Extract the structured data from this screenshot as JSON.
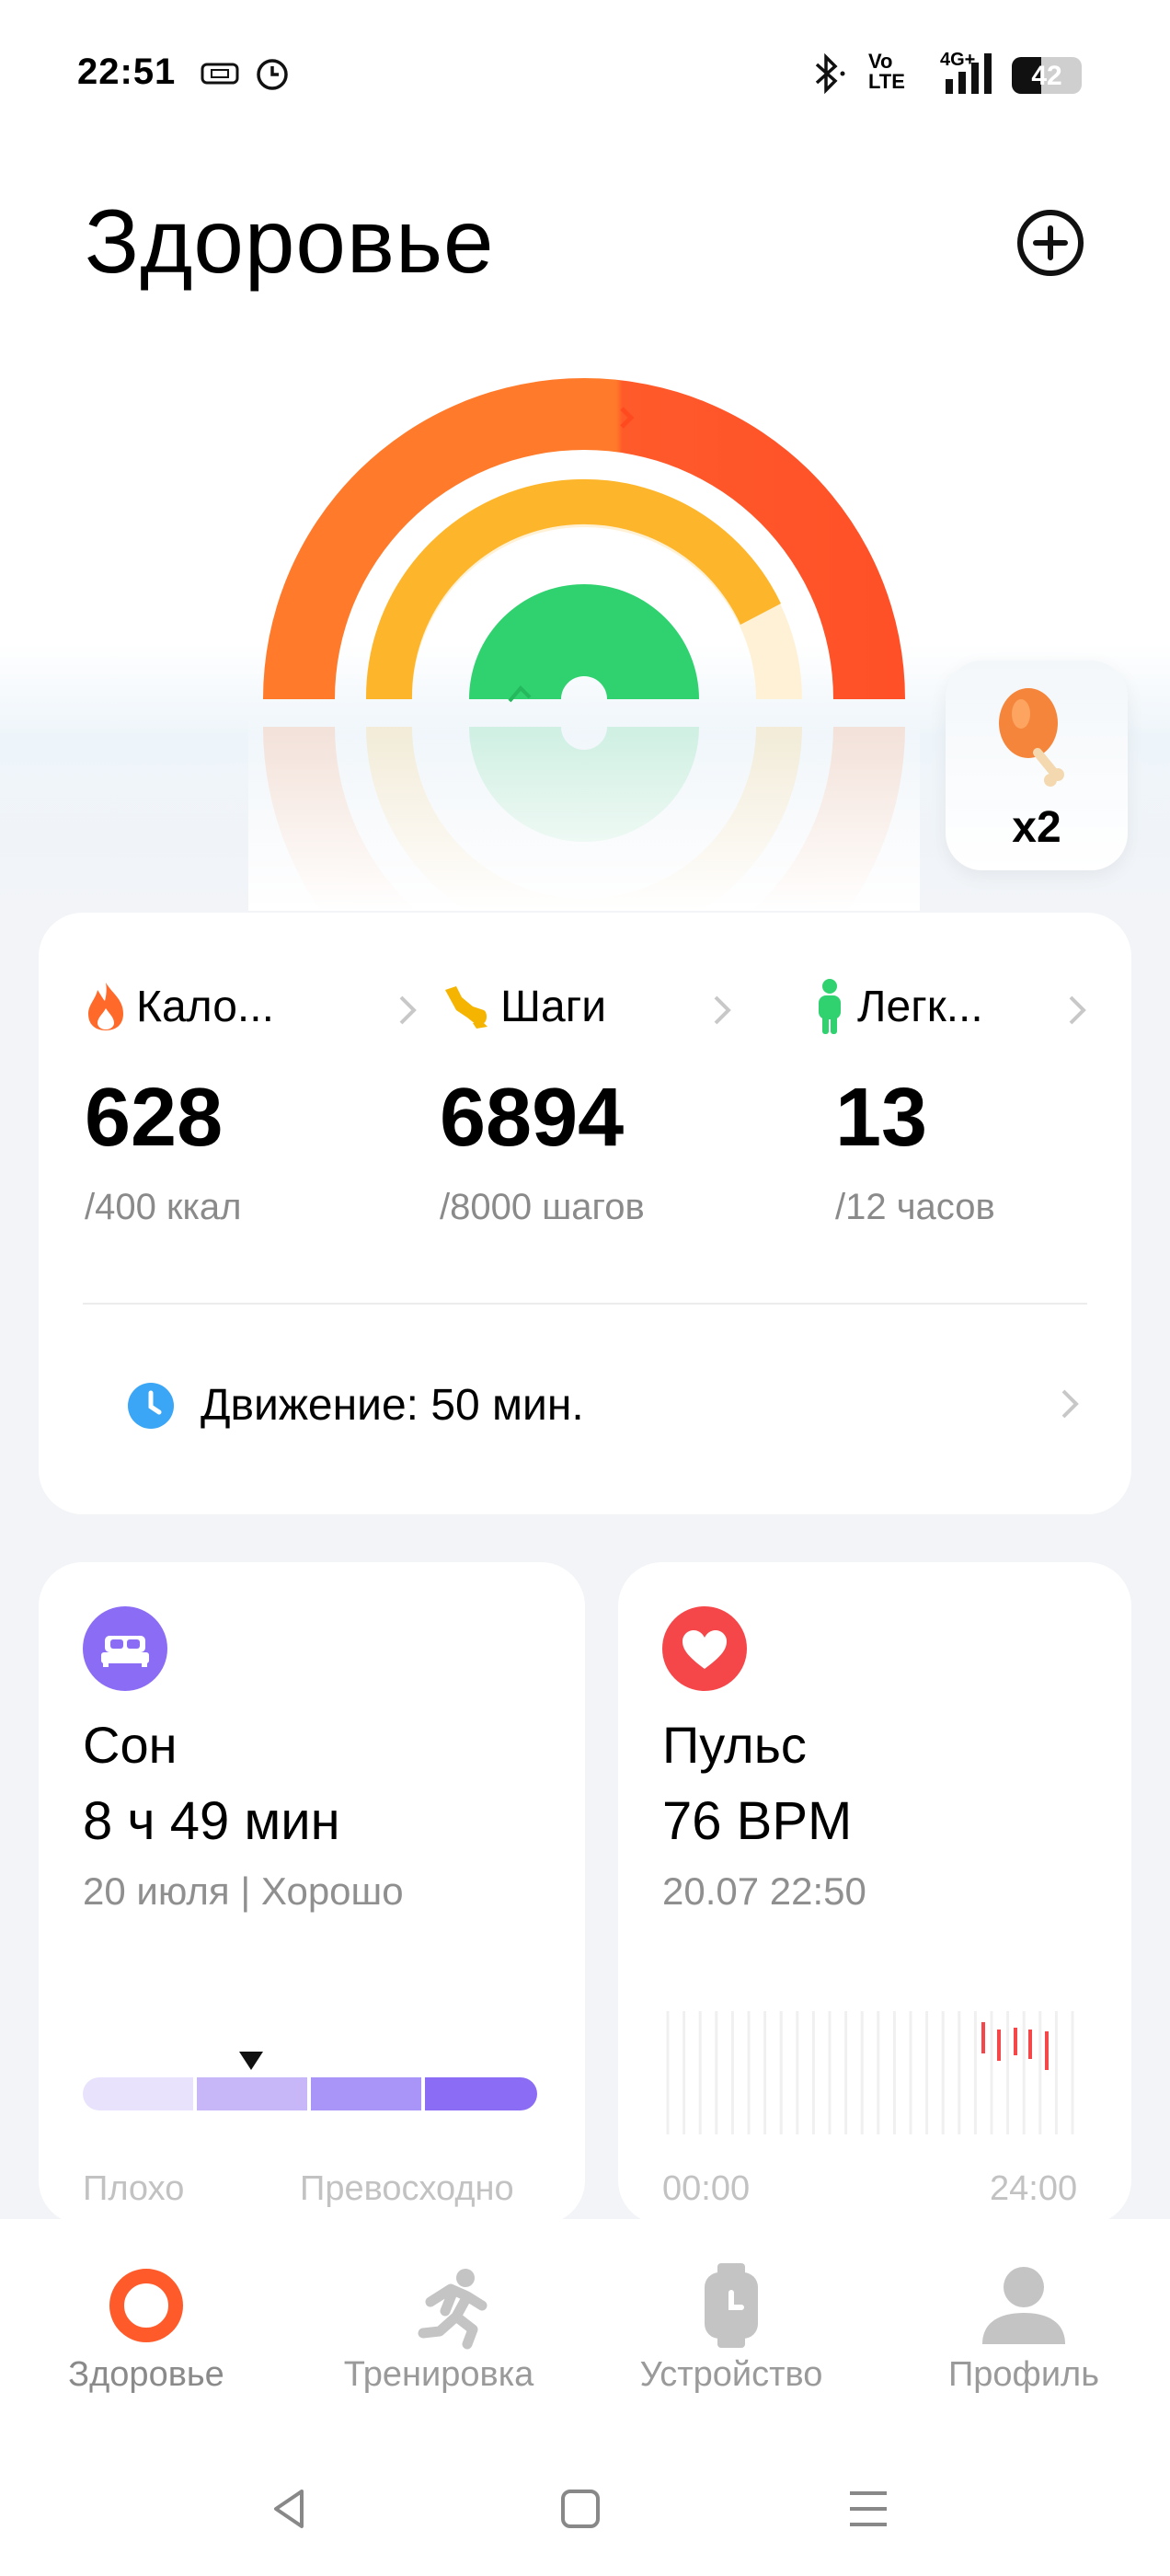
{
  "status_bar": {
    "time": "22:51",
    "network_label": "4G+",
    "volte_label": "Vo\nLTE",
    "battery": "42"
  },
  "header": {
    "title": "Здоровье",
    "add_icon": "plus-circle-icon"
  },
  "gauge": {
    "calories_progress": 1.0,
    "steps_progress": 0.86,
    "active_hours_progress": 1.0,
    "colors": {
      "outer": "#ff6a2a",
      "middle": "#fdb62b",
      "inner": "#2fd26f",
      "track": "#fff1d6"
    }
  },
  "reward": {
    "icon": "drumstick-icon",
    "count": "x2"
  },
  "summary": {
    "metrics": [
      {
        "label": "Кало...",
        "value": "628",
        "goal": "/400 ккал",
        "icon": "flame-icon",
        "color": "#ff6a2a"
      },
      {
        "label": "Шаги",
        "value": "6894",
        "goal": "/8000 шагов",
        "icon": "shoe-icon",
        "color": "#f5b400"
      },
      {
        "label": "Легк...",
        "value": "13",
        "goal": "/12 часов",
        "icon": "person-icon",
        "color": "#2fd26f"
      }
    ],
    "movement": {
      "text": "Движение: 50 мин.",
      "icon": "clock-icon",
      "color": "#3aa6f5"
    }
  },
  "sleep": {
    "title": "Сон",
    "value": "8 ч 49 мин",
    "date": "20 июля | Хорошо",
    "scale_low": "Плохо",
    "scale_high": "Превосходно",
    "quality_level": 0.37,
    "icon": "bed-icon",
    "color": "#8b6cf5"
  },
  "pulse": {
    "title": "Пульс",
    "value": "76 BPM",
    "date": "20.07 22:50",
    "axis_start": "00:00",
    "axis_end": "24:00",
    "icon": "heart-icon",
    "color": "#f5474a"
  },
  "bottom_nav": {
    "items": [
      {
        "label": "Здоровье",
        "icon": "ring-icon",
        "active": true
      },
      {
        "label": "Тренировка",
        "icon": "runner-icon",
        "active": false
      },
      {
        "label": "Устройство",
        "icon": "watch-icon",
        "active": false
      },
      {
        "label": "Профиль",
        "icon": "profile-icon",
        "active": false
      }
    ]
  }
}
